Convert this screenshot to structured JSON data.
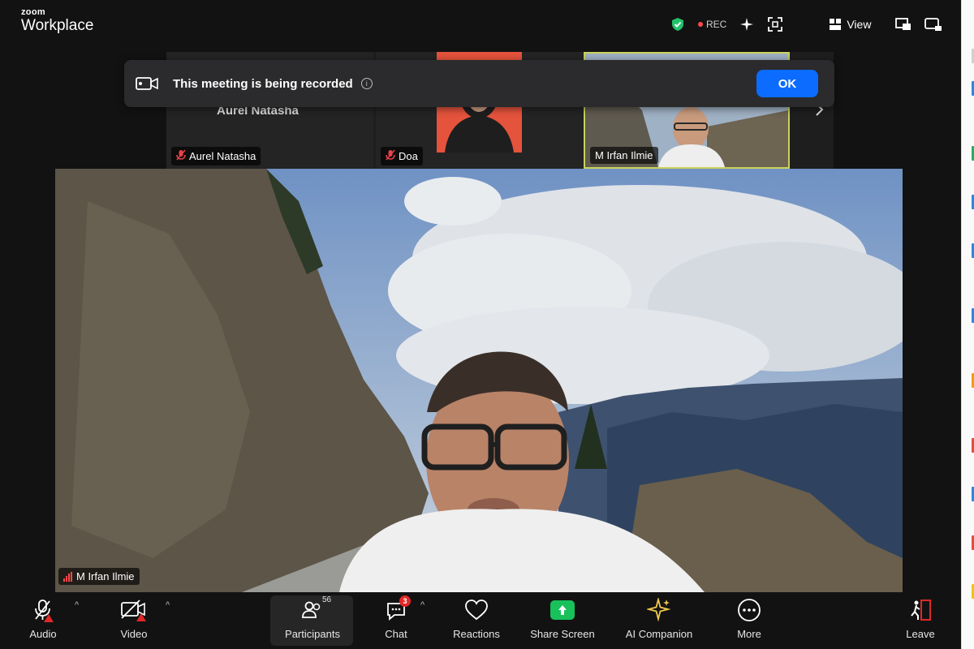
{
  "app": {
    "brand_small": "zoom",
    "brand_name": "Workplace"
  },
  "topbar": {
    "rec_label": "REC",
    "view_label": "View",
    "icons": [
      "shield-check-icon",
      "rec-indicator-icon",
      "sparkle-icon",
      "expand-icon",
      "view-grid-icon",
      "picture-in-picture-icon",
      "minimize-window-icon"
    ]
  },
  "banner": {
    "message": "This meeting is being recorded",
    "ok_label": "OK"
  },
  "thumbnails": [
    {
      "name": "Aurel Natasha",
      "display_name": "Aurel Natasha",
      "muted": true
    },
    {
      "name": "Doa",
      "muted": true
    },
    {
      "name": "M Irfan Ilmie",
      "muted": false,
      "active": true
    }
  ],
  "main_video": {
    "speaker": "M Irfan Ilmie"
  },
  "toolbar": {
    "audio_label": "Audio",
    "video_label": "Video",
    "participants_label": "Participants",
    "participants_count": "56",
    "chat_label": "Chat",
    "chat_badge": "3",
    "reactions_label": "Reactions",
    "share_label": "Share Screen",
    "ai_label": "AI Companion",
    "more_label": "More",
    "leave_label": "Leave"
  },
  "colors": {
    "accent_blue": "#0b6cff",
    "share_green": "#18c15a",
    "alert_red": "#e02828",
    "active_border": "#c9d35a"
  }
}
